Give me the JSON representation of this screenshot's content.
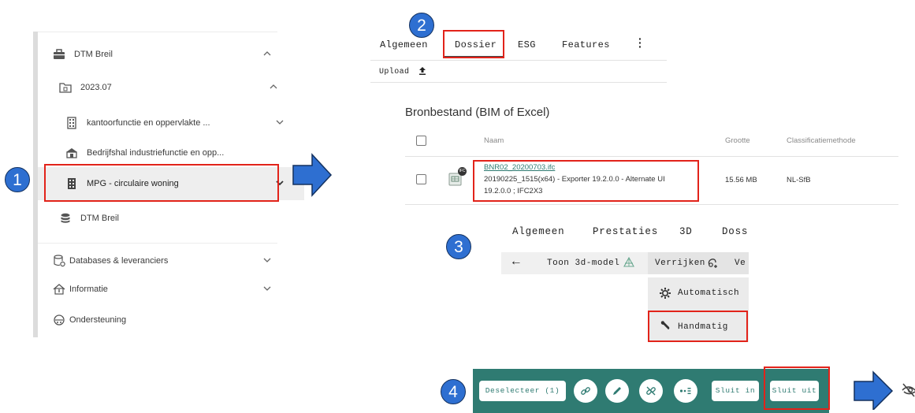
{
  "steps": [
    "1",
    "2",
    "3",
    "4"
  ],
  "sidebar": {
    "items": [
      {
        "label": "DTM Breil",
        "icon": "briefcase-icon"
      },
      {
        "label": "2023.07",
        "icon": "folder-icon"
      },
      {
        "label": "kantoorfunctie en oppervlakte ...",
        "icon": "building-icon"
      },
      {
        "label": "Bedrijfshal industriefunctie en opp...",
        "icon": "warehouse-icon"
      },
      {
        "label": "MPG - circulaire woning",
        "icon": "building-icon",
        "selected": true
      },
      {
        "label": "DTM Breil",
        "icon": "database-icon"
      },
      {
        "label": "Databases & leveranciers",
        "icon": "database-settings-icon"
      },
      {
        "label": "Informatie",
        "icon": "info-home-icon"
      },
      {
        "label": "Ondersteuning",
        "icon": "support-icon"
      }
    ]
  },
  "dossier": {
    "tabs": [
      "Algemeen",
      "Dossier",
      "ESG",
      "Features"
    ],
    "active_tab": "Dossier",
    "upload_label": "Upload",
    "section_title": "Bronbestand (BIM of Excel)",
    "columns": [
      "Naam",
      "Grootte",
      "Classificatiemethode"
    ],
    "rows": [
      {
        "file_link": "BNR02_20200703.ifc",
        "desc_line1": "20190225_1515(x64) - Exporter 19.2.0.0 - Alternate UI",
        "desc_line2": "19.2.0.0 ; IFC2X3",
        "size": "15.56 MB",
        "classification": "NL-SfB",
        "badge": "IFC"
      }
    ]
  },
  "model_menu": {
    "tabs": [
      "Algemeen",
      "Prestaties",
      "3D",
      "Doss"
    ],
    "back_label": "←",
    "toon_label": "Toon 3d-model",
    "verrijken_label": "Verrijken",
    "partial_label": "Ve",
    "dropdown": [
      "Automatisch",
      "Handmatig"
    ]
  },
  "toolbar": {
    "deselect_label": "Deselecteer (1)",
    "sluit_in_label": "Sluit in",
    "sluit_uit_label": "Sluit uit"
  },
  "colors": {
    "accent_blue": "#2e6fd1",
    "highlight_red": "#e2231a",
    "toolbar_teal": "#2f7b72"
  }
}
